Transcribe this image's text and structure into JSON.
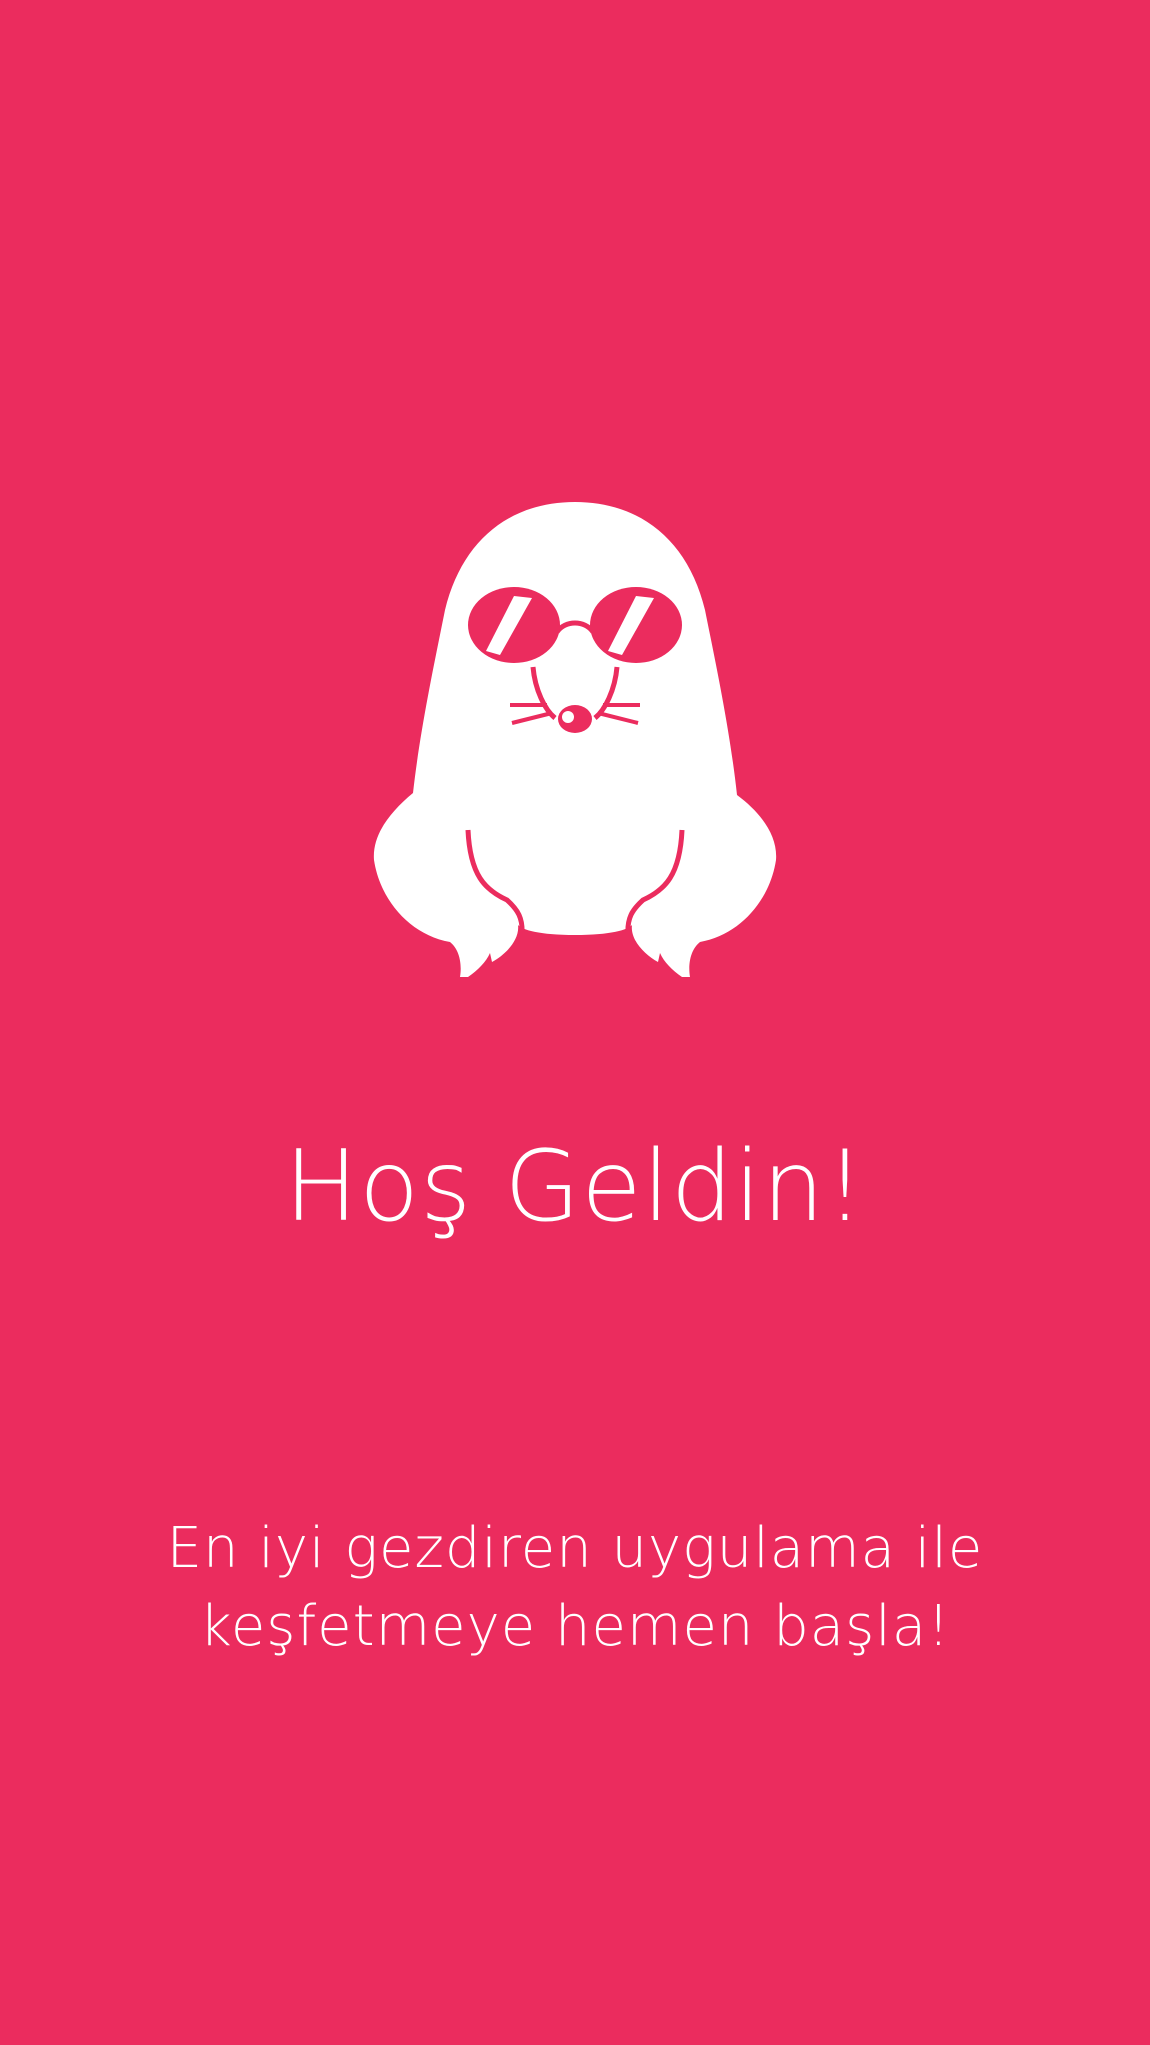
{
  "colors": {
    "background": "#EB2C5E",
    "foreground": "#FFFFFF"
  },
  "mascot": {
    "icon": "seal-with-sunglasses-icon"
  },
  "welcome": {
    "title": "Hoş Geldin!",
    "subtitle_lines": [
      "En iyi gezdiren uygulama ile",
      "keşfetmeye hemen başla!"
    ]
  }
}
